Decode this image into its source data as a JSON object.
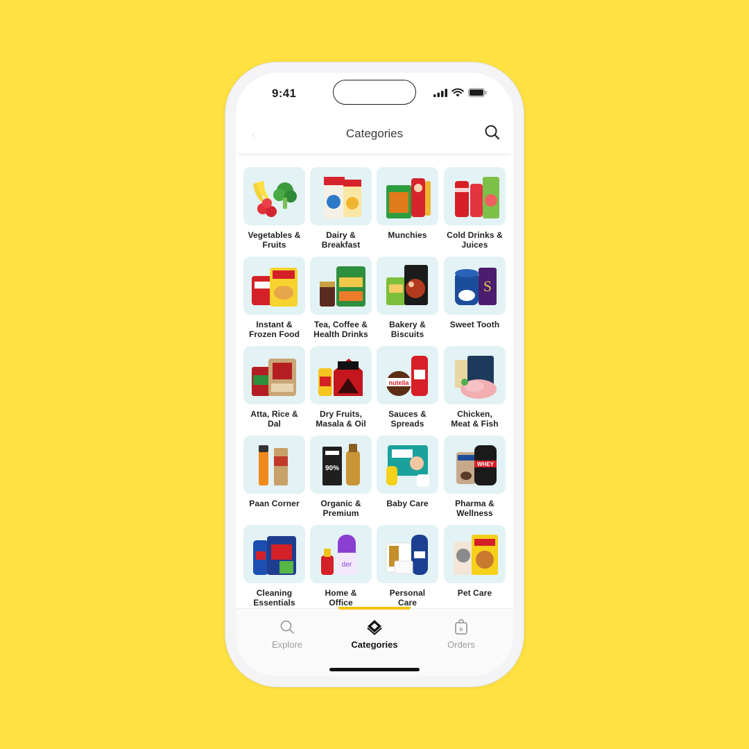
{
  "status": {
    "time": "9:41"
  },
  "header": {
    "title": "Categories"
  },
  "categories": [
    {
      "label": "Vegetables &\nFruits",
      "icon": "produce-icon"
    },
    {
      "label": "Dairy &\nBreakfast",
      "icon": "cereal-icon"
    },
    {
      "label": "Munchies",
      "icon": "snacks-icon"
    },
    {
      "label": "Cold Drinks &\nJuices",
      "icon": "drinks-icon"
    },
    {
      "label": "Instant &\nFrozen Food",
      "icon": "noodles-icon"
    },
    {
      "label": "Tea, Coffee &\nHealth Drinks",
      "icon": "tea-icon"
    },
    {
      "label": "Bakery &\nBiscuits",
      "icon": "bakery-icon"
    },
    {
      "label": "Sweet Tooth",
      "icon": "sweets-icon"
    },
    {
      "label": "Atta, Rice &\nDal",
      "icon": "grains-icon"
    },
    {
      "label": "Dry Fruits,\nMasala & Oil",
      "icon": "masala-icon"
    },
    {
      "label": "Sauces &\nSpreads",
      "icon": "sauce-icon"
    },
    {
      "label": "Chicken,\nMeat & Fish",
      "icon": "meat-icon"
    },
    {
      "label": "Paan Corner",
      "icon": "lighter-icon"
    },
    {
      "label": "Organic &\nPremium",
      "icon": "organic-icon"
    },
    {
      "label": "Baby Care",
      "icon": "baby-icon"
    },
    {
      "label": "Pharma &\nWellness",
      "icon": "pharma-icon"
    },
    {
      "label": "Cleaning\nEssentials",
      "icon": "cleaning-icon"
    },
    {
      "label": "Home &\nOffice",
      "icon": "home-icon"
    },
    {
      "label": "Personal\nCare",
      "icon": "personal-care-icon"
    },
    {
      "label": "Pet Care",
      "icon": "pet-icon"
    }
  ],
  "tabs": [
    {
      "label": "Explore",
      "icon": "search-icon",
      "active": false
    },
    {
      "label": "Categories",
      "icon": "categories-icon",
      "active": true
    },
    {
      "label": "Orders",
      "icon": "bag-icon",
      "active": false
    }
  ],
  "colors": {
    "background": "#FFE141",
    "accent": "#F7C200",
    "tile": "#E3F2F4"
  }
}
